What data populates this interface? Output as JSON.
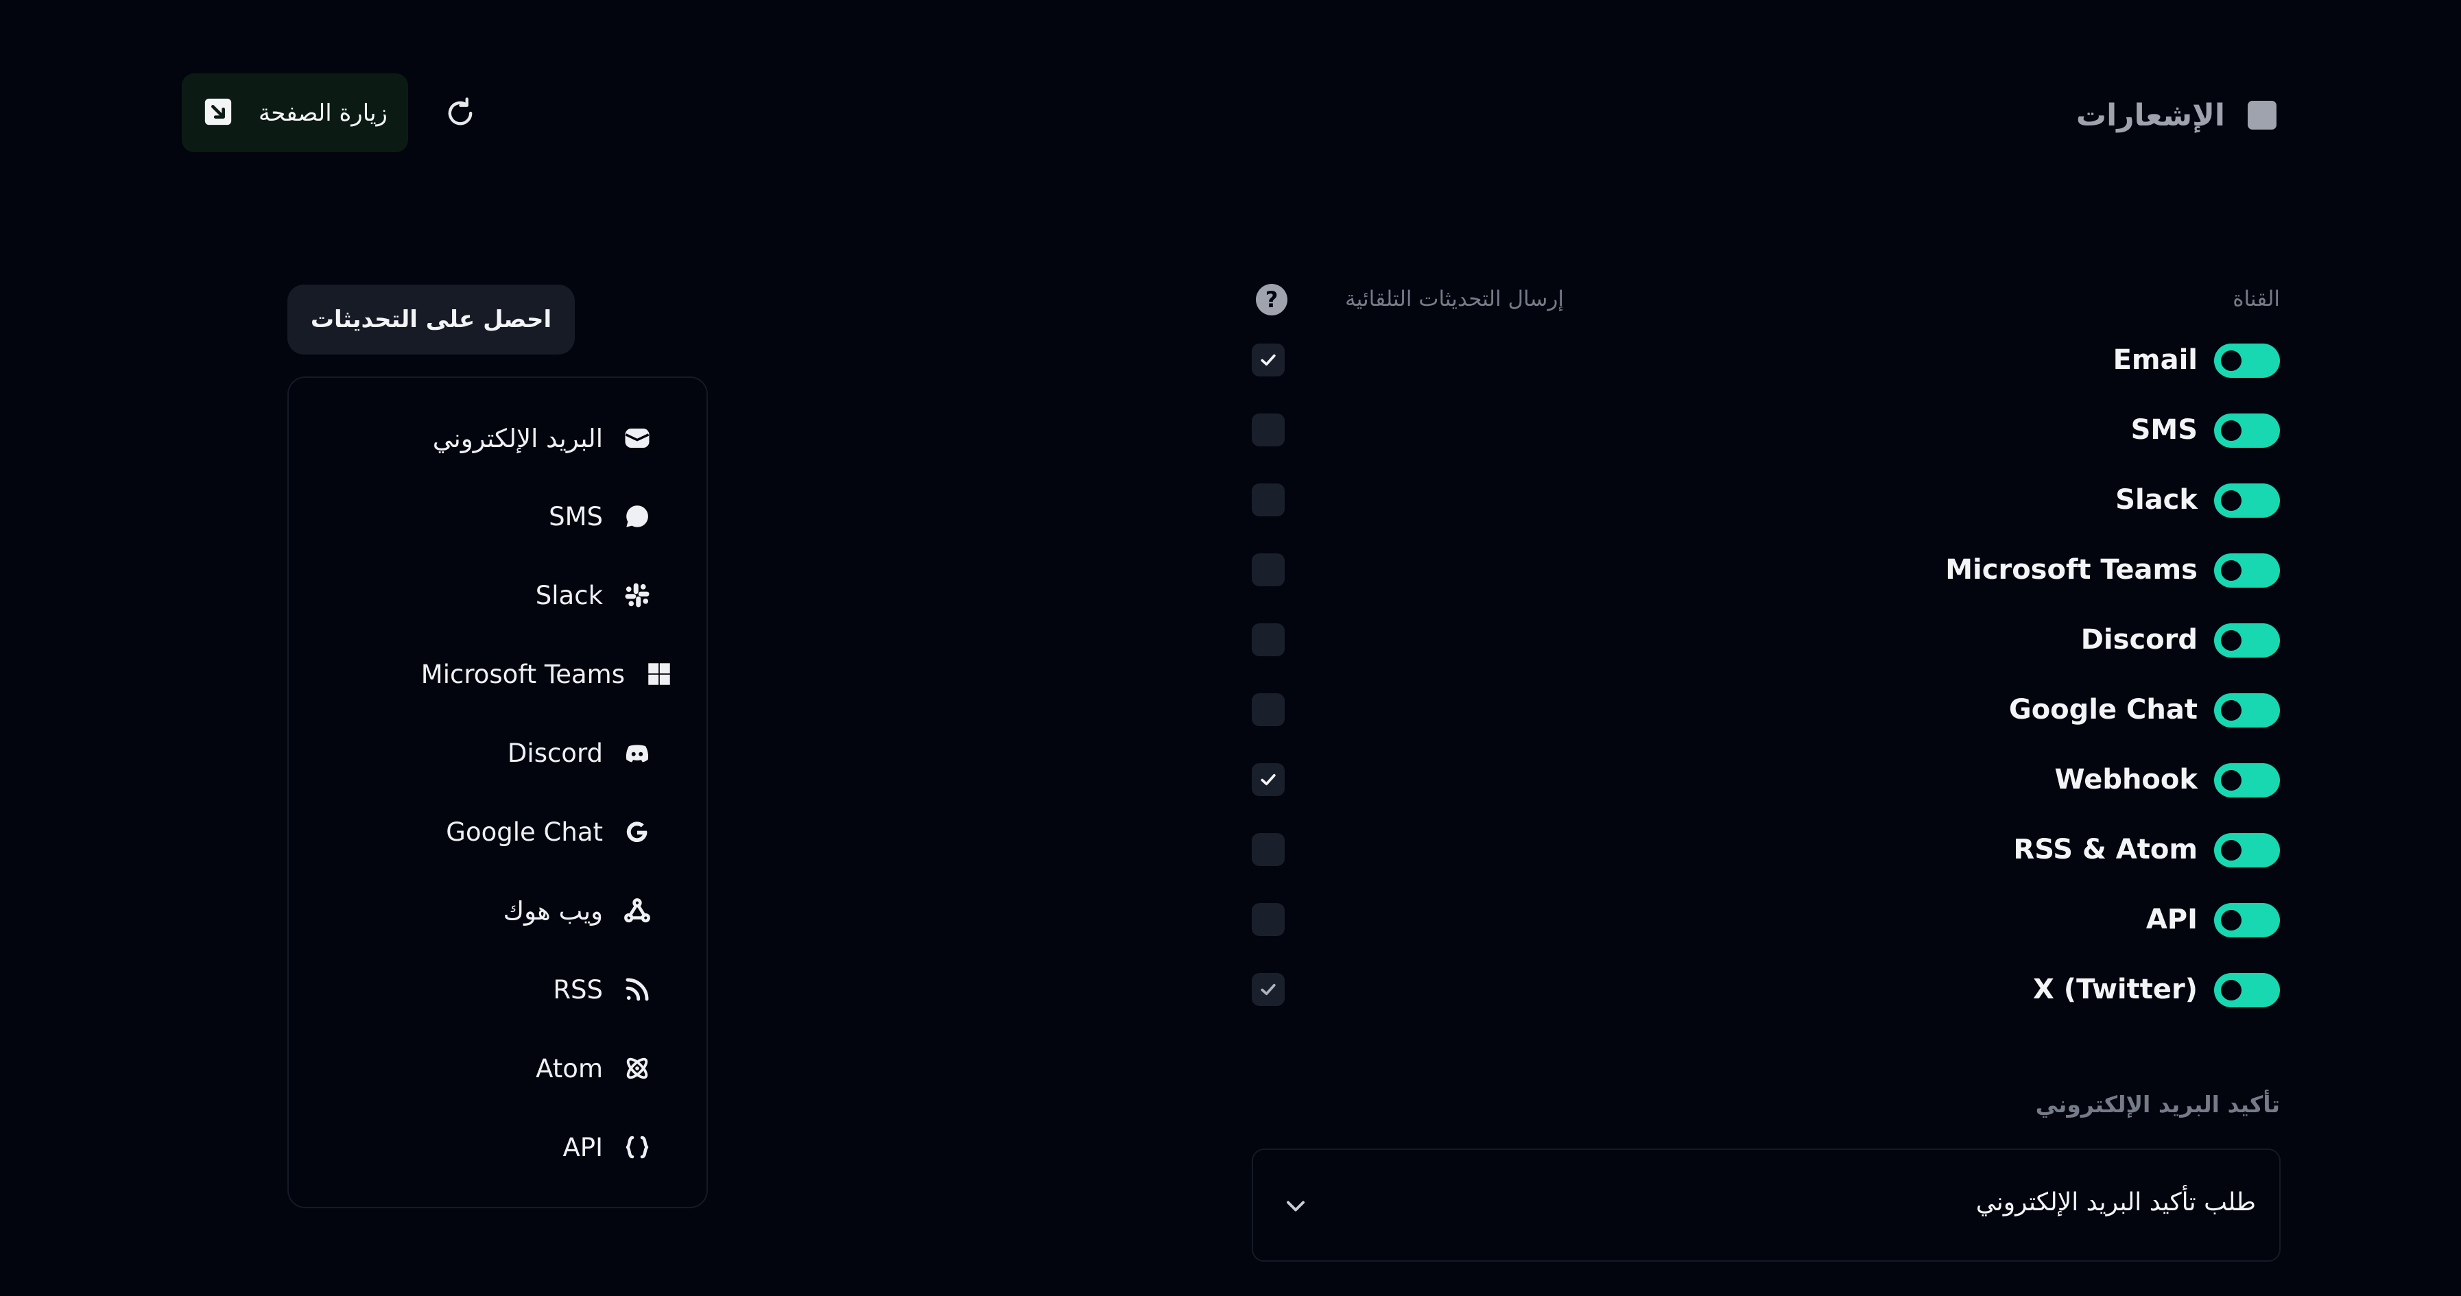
{
  "header": {
    "title": "الإشعارات",
    "visit_label": "زيارة الصفحة"
  },
  "sidebar": {
    "get_updates_label": "احصل على التحديثات",
    "items": [
      {
        "label": "البريد الإلكتروني",
        "icon": "mail-icon"
      },
      {
        "label": "SMS",
        "icon": "chat-bubble-icon"
      },
      {
        "label": "Slack",
        "icon": "slack-icon"
      },
      {
        "label": "Microsoft Teams",
        "icon": "windows-icon"
      },
      {
        "label": "Discord",
        "icon": "discord-icon"
      },
      {
        "label": "Google Chat",
        "icon": "google-icon"
      },
      {
        "label": "ويب هوك",
        "icon": "webhook-icon"
      },
      {
        "label": "RSS",
        "icon": "rss-icon"
      },
      {
        "label": "Atom",
        "icon": "atom-icon"
      },
      {
        "label": "API",
        "icon": "braces-icon"
      }
    ]
  },
  "channels": {
    "channel_header": "القناة",
    "auto_updates_header": "إرسال التحديثات التلقائية",
    "rows": [
      {
        "label": "Email",
        "enabled": true,
        "auto_update": true
      },
      {
        "label": "SMS",
        "enabled": true,
        "auto_update": false
      },
      {
        "label": "Slack",
        "enabled": true,
        "auto_update": false
      },
      {
        "label": "Microsoft Teams",
        "enabled": true,
        "auto_update": false
      },
      {
        "label": "Discord",
        "enabled": true,
        "auto_update": false
      },
      {
        "label": "Google Chat",
        "enabled": true,
        "auto_update": false
      },
      {
        "label": "Webhook",
        "enabled": true,
        "auto_update": true
      },
      {
        "label": "RSS & Atom",
        "enabled": true,
        "auto_update": false
      },
      {
        "label": "API",
        "enabled": true,
        "auto_update": false
      },
      {
        "label": "X (Twitter)",
        "enabled": true,
        "auto_update": true
      }
    ]
  },
  "email_confirmation": {
    "label": "تأكيد البريد الإلكتروني",
    "selected": "طلب تأكيد البريد الإلكتروني"
  },
  "colors": {
    "background": "#03050e",
    "accent": "#18d8b1",
    "muted_text": "#757b88"
  }
}
